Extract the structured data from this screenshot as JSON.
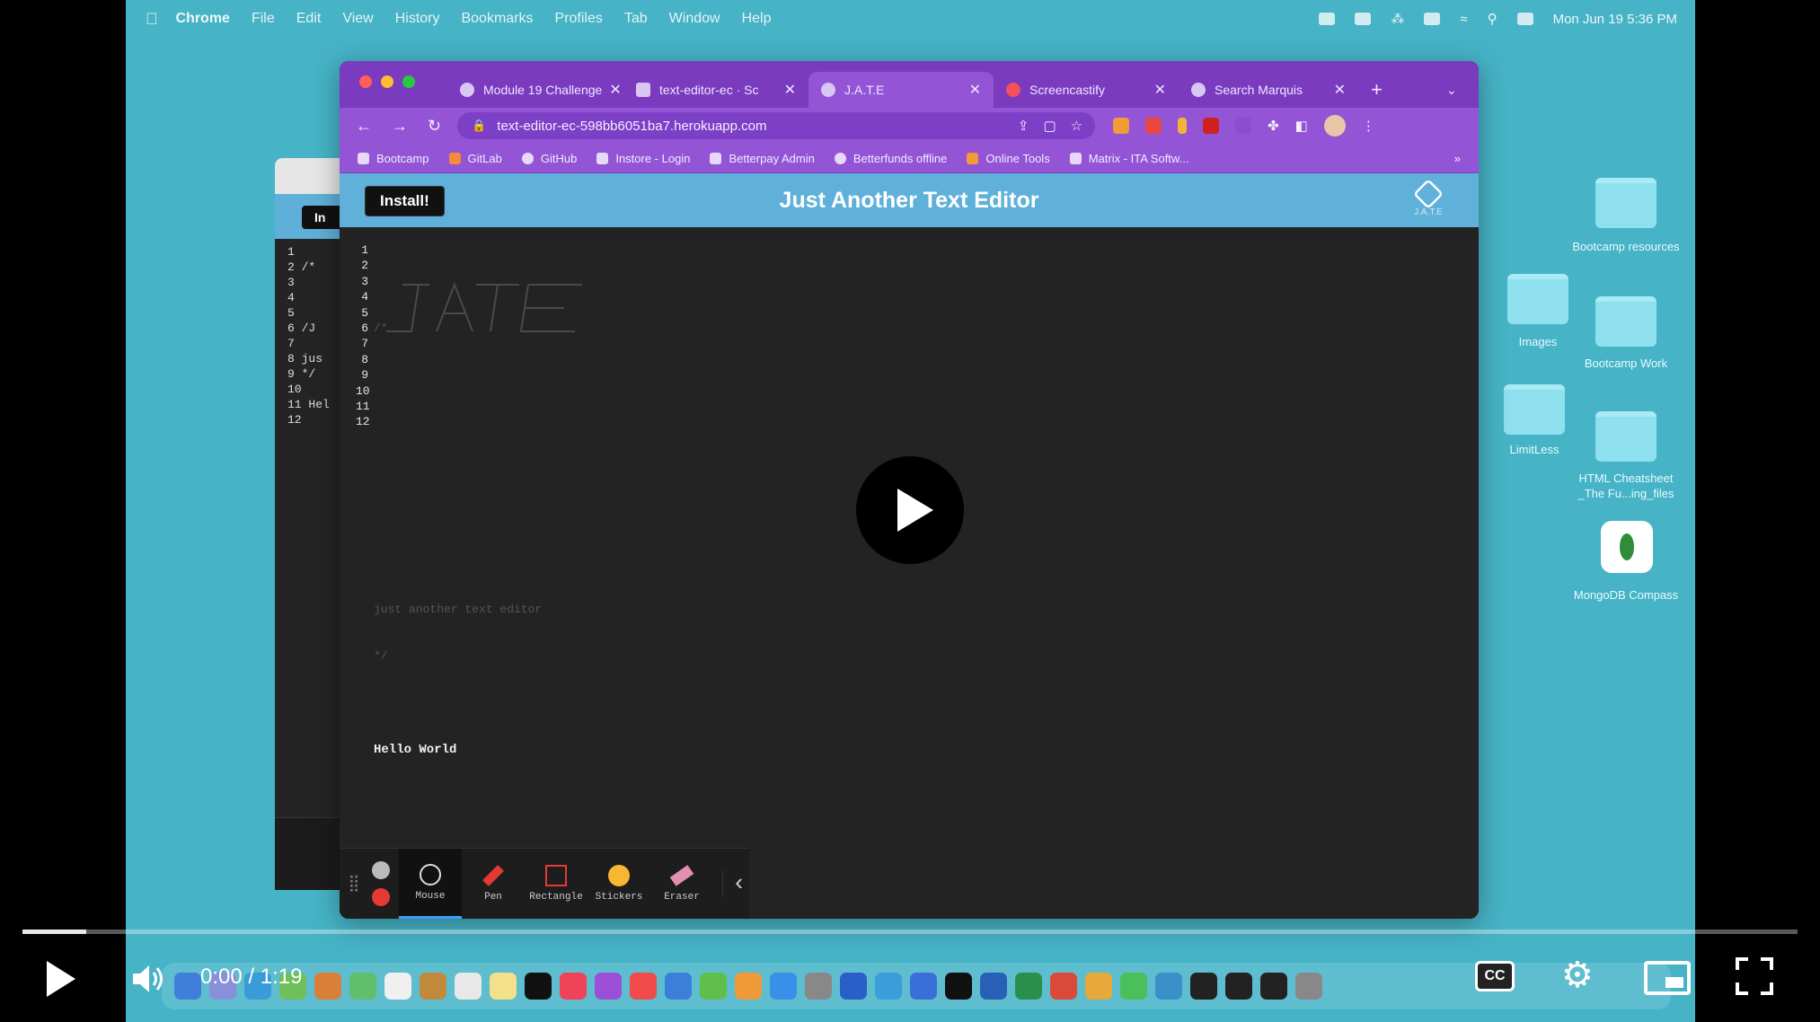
{
  "menubar": {
    "app": "Chrome",
    "items": [
      "File",
      "Edit",
      "View",
      "History",
      "Bookmarks",
      "Profiles",
      "Tab",
      "Window",
      "Help"
    ],
    "clock": "Mon Jun 19 5:36 PM"
  },
  "desktop": {
    "icons": [
      {
        "label": "Bootcamp resources"
      },
      {
        "label": "Images"
      },
      {
        "label": "Bootcamp Work"
      },
      {
        "label": "LimitLess"
      },
      {
        "label": "HTML Cheatsheet _The Fu...ing_files"
      },
      {
        "label": "MongoDB Compass"
      }
    ]
  },
  "background_window": {
    "button_label": "In",
    "lines": [
      "1",
      "2 /*",
      "3",
      "4",
      "5",
      "6 /J",
      "7",
      "8 jus",
      "9 */",
      "10",
      "11 Hel",
      "12"
    ]
  },
  "browser": {
    "tabs": [
      {
        "label": "Module 19 Challenge",
        "active": false
      },
      {
        "label": "text-editor-ec · Sc",
        "active": false
      },
      {
        "label": "J.A.T.E",
        "active": true
      },
      {
        "label": "Screencastify",
        "active": false
      },
      {
        "label": "Search Marquis",
        "active": false
      }
    ],
    "url": "text-editor-ec-598bb6051ba7.herokuapp.com",
    "bookmarks": [
      "Bootcamp",
      "GitLab",
      "GitHub",
      "Instore - Login",
      "Betterpay Admin",
      "Betterfunds offline",
      "Online Tools",
      "Matrix - ITA Softw..."
    ]
  },
  "app": {
    "install_label": "Install!",
    "title": "Just Another Text Editor",
    "logo_caption": "J.A.T.E",
    "line_numbers": [
      "1",
      "2",
      "3",
      "4",
      "5",
      "6",
      "7",
      "8",
      "9",
      "10",
      "11",
      "12"
    ],
    "code_lines": [
      "",
      "/*",
      "",
      "",
      "",
      "",
      "",
      "just another text editor",
      "*/",
      "",
      "Hello World",
      ""
    ]
  },
  "screencastify": {
    "tools": [
      "Mouse",
      "Pen",
      "Rectangle",
      "Stickers",
      "Eraser"
    ],
    "active_tool": "Mouse"
  },
  "player": {
    "time": "0:00 / 1:19",
    "cc_label": "CC",
    "progress_fraction": 0.036
  },
  "colors": {
    "desktop": "#46b3c6",
    "chrome_theme": "#9355d6",
    "app_header": "#5fb1d9",
    "editor_bg": "#232323"
  }
}
